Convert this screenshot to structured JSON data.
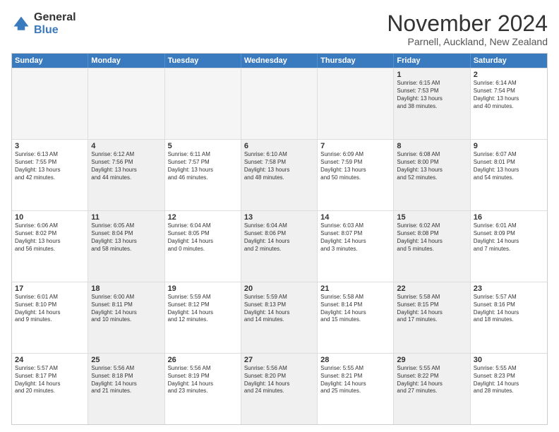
{
  "logo": {
    "general": "General",
    "blue": "Blue"
  },
  "title": "November 2024",
  "subtitle": "Parnell, Auckland, New Zealand",
  "weekdays": [
    "Sunday",
    "Monday",
    "Tuesday",
    "Wednesday",
    "Thursday",
    "Friday",
    "Saturday"
  ],
  "rows": [
    [
      {
        "day": "",
        "info": "",
        "empty": true
      },
      {
        "day": "",
        "info": "",
        "empty": true
      },
      {
        "day": "",
        "info": "",
        "empty": true
      },
      {
        "day": "",
        "info": "",
        "empty": true
      },
      {
        "day": "",
        "info": "",
        "empty": true
      },
      {
        "day": "1",
        "info": "Sunrise: 6:15 AM\nSunset: 7:53 PM\nDaylight: 13 hours\nand 38 minutes.",
        "shaded": true
      },
      {
        "day": "2",
        "info": "Sunrise: 6:14 AM\nSunset: 7:54 PM\nDaylight: 13 hours\nand 40 minutes.",
        "shaded": false
      }
    ],
    [
      {
        "day": "3",
        "info": "Sunrise: 6:13 AM\nSunset: 7:55 PM\nDaylight: 13 hours\nand 42 minutes."
      },
      {
        "day": "4",
        "info": "Sunrise: 6:12 AM\nSunset: 7:56 PM\nDaylight: 13 hours\nand 44 minutes.",
        "shaded": true
      },
      {
        "day": "5",
        "info": "Sunrise: 6:11 AM\nSunset: 7:57 PM\nDaylight: 13 hours\nand 46 minutes."
      },
      {
        "day": "6",
        "info": "Sunrise: 6:10 AM\nSunset: 7:58 PM\nDaylight: 13 hours\nand 48 minutes.",
        "shaded": true
      },
      {
        "day": "7",
        "info": "Sunrise: 6:09 AM\nSunset: 7:59 PM\nDaylight: 13 hours\nand 50 minutes."
      },
      {
        "day": "8",
        "info": "Sunrise: 6:08 AM\nSunset: 8:00 PM\nDaylight: 13 hours\nand 52 minutes.",
        "shaded": true
      },
      {
        "day": "9",
        "info": "Sunrise: 6:07 AM\nSunset: 8:01 PM\nDaylight: 13 hours\nand 54 minutes."
      }
    ],
    [
      {
        "day": "10",
        "info": "Sunrise: 6:06 AM\nSunset: 8:02 PM\nDaylight: 13 hours\nand 56 minutes."
      },
      {
        "day": "11",
        "info": "Sunrise: 6:05 AM\nSunset: 8:04 PM\nDaylight: 13 hours\nand 58 minutes.",
        "shaded": true
      },
      {
        "day": "12",
        "info": "Sunrise: 6:04 AM\nSunset: 8:05 PM\nDaylight: 14 hours\nand 0 minutes."
      },
      {
        "day": "13",
        "info": "Sunrise: 6:04 AM\nSunset: 8:06 PM\nDaylight: 14 hours\nand 2 minutes.",
        "shaded": true
      },
      {
        "day": "14",
        "info": "Sunrise: 6:03 AM\nSunset: 8:07 PM\nDaylight: 14 hours\nand 3 minutes."
      },
      {
        "day": "15",
        "info": "Sunrise: 6:02 AM\nSunset: 8:08 PM\nDaylight: 14 hours\nand 5 minutes.",
        "shaded": true
      },
      {
        "day": "16",
        "info": "Sunrise: 6:01 AM\nSunset: 8:09 PM\nDaylight: 14 hours\nand 7 minutes."
      }
    ],
    [
      {
        "day": "17",
        "info": "Sunrise: 6:01 AM\nSunset: 8:10 PM\nDaylight: 14 hours\nand 9 minutes."
      },
      {
        "day": "18",
        "info": "Sunrise: 6:00 AM\nSunset: 8:11 PM\nDaylight: 14 hours\nand 10 minutes.",
        "shaded": true
      },
      {
        "day": "19",
        "info": "Sunrise: 5:59 AM\nSunset: 8:12 PM\nDaylight: 14 hours\nand 12 minutes."
      },
      {
        "day": "20",
        "info": "Sunrise: 5:59 AM\nSunset: 8:13 PM\nDaylight: 14 hours\nand 14 minutes.",
        "shaded": true
      },
      {
        "day": "21",
        "info": "Sunrise: 5:58 AM\nSunset: 8:14 PM\nDaylight: 14 hours\nand 15 minutes."
      },
      {
        "day": "22",
        "info": "Sunrise: 5:58 AM\nSunset: 8:15 PM\nDaylight: 14 hours\nand 17 minutes.",
        "shaded": true
      },
      {
        "day": "23",
        "info": "Sunrise: 5:57 AM\nSunset: 8:16 PM\nDaylight: 14 hours\nand 18 minutes."
      }
    ],
    [
      {
        "day": "24",
        "info": "Sunrise: 5:57 AM\nSunset: 8:17 PM\nDaylight: 14 hours\nand 20 minutes."
      },
      {
        "day": "25",
        "info": "Sunrise: 5:56 AM\nSunset: 8:18 PM\nDaylight: 14 hours\nand 21 minutes.",
        "shaded": true
      },
      {
        "day": "26",
        "info": "Sunrise: 5:56 AM\nSunset: 8:19 PM\nDaylight: 14 hours\nand 23 minutes."
      },
      {
        "day": "27",
        "info": "Sunrise: 5:56 AM\nSunset: 8:20 PM\nDaylight: 14 hours\nand 24 minutes.",
        "shaded": true
      },
      {
        "day": "28",
        "info": "Sunrise: 5:55 AM\nSunset: 8:21 PM\nDaylight: 14 hours\nand 25 minutes."
      },
      {
        "day": "29",
        "info": "Sunrise: 5:55 AM\nSunset: 8:22 PM\nDaylight: 14 hours\nand 27 minutes.",
        "shaded": true
      },
      {
        "day": "30",
        "info": "Sunrise: 5:55 AM\nSunset: 8:23 PM\nDaylight: 14 hours\nand 28 minutes."
      }
    ]
  ]
}
